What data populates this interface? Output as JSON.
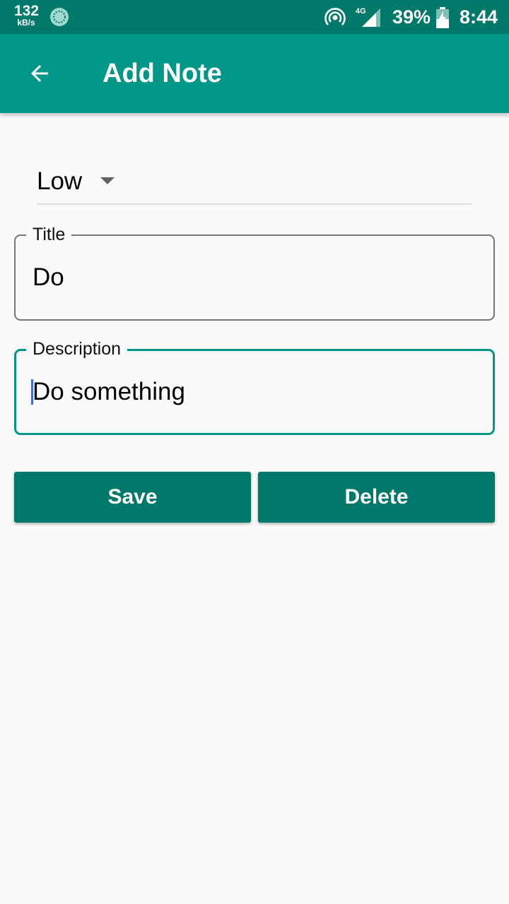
{
  "status_bar": {
    "network_speed": "132",
    "network_speed_unit": "kB/s",
    "network_type": "4G",
    "battery_percent": "39%",
    "time": "8:44",
    "icons": [
      "sync-icon",
      "hotspot-icon",
      "signal-icon",
      "battery-charging-icon"
    ]
  },
  "app_bar": {
    "title": "Add Note",
    "back_icon": "arrow-back-icon"
  },
  "form": {
    "priority": {
      "selected": "Low",
      "icon": "dropdown-caret-icon"
    },
    "title_field": {
      "label": "Title",
      "value": "Do"
    },
    "description_field": {
      "label": "Description",
      "value": "Do something"
    },
    "buttons": {
      "save_label": "Save",
      "delete_label": "Delete"
    }
  },
  "colors": {
    "status_bar": "#00796b",
    "app_bar": "#009688",
    "button": "#00796b",
    "focused_border": "#009688",
    "background": "#fafafa"
  }
}
